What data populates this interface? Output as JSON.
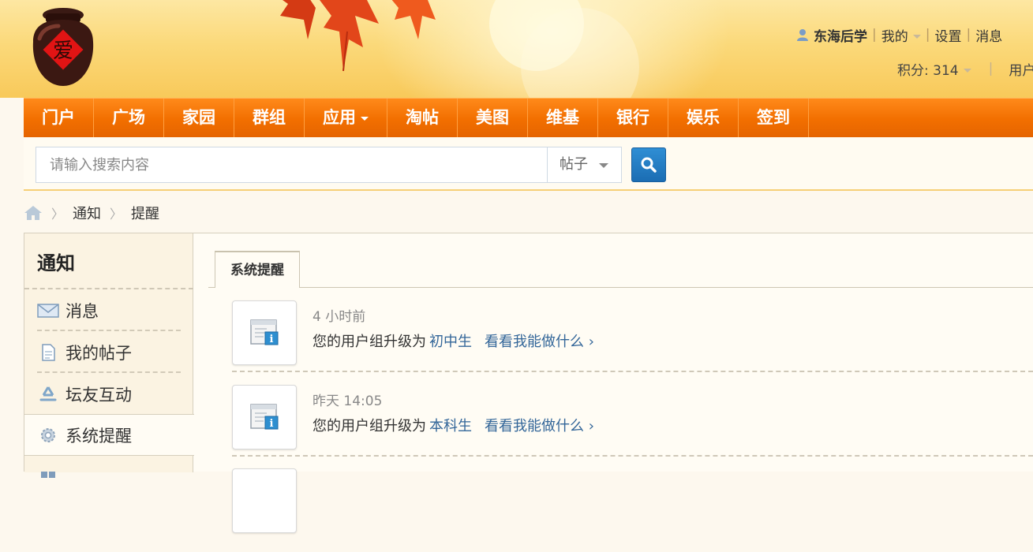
{
  "header": {
    "user_name": "东海后学",
    "user_links": [
      "我的",
      "设置",
      "消息"
    ],
    "credits_label": "积分: 314",
    "trailing_link": "用户"
  },
  "nav": {
    "items": [
      {
        "label": "门户"
      },
      {
        "label": "广场"
      },
      {
        "label": "家园"
      },
      {
        "label": "群组"
      },
      {
        "label": "应用",
        "dropdown": true
      },
      {
        "label": "淘帖"
      },
      {
        "label": "美图"
      },
      {
        "label": "维基"
      },
      {
        "label": "银行"
      },
      {
        "label": "娱乐"
      },
      {
        "label": "签到"
      }
    ]
  },
  "search": {
    "placeholder": "请输入搜索内容",
    "value": "",
    "type_selected": "帖子"
  },
  "breadcrumb": {
    "items": [
      "通知",
      "提醒"
    ]
  },
  "sidebar": {
    "title": "通知",
    "items": [
      {
        "label": "消息",
        "icon": "envelope-icon"
      },
      {
        "label": "我的帖子",
        "icon": "document-icon"
      },
      {
        "label": "坛友互动",
        "icon": "recycle-icon"
      },
      {
        "label": "系统提醒",
        "icon": "gear-icon",
        "active": true
      }
    ]
  },
  "tabs": {
    "active": "系统提醒"
  },
  "notices": [
    {
      "time": "4 小时前",
      "text": "您的用户组升级为",
      "group": "初中生",
      "more": "看看我能做什么 ›"
    },
    {
      "time": "昨天 14:05",
      "text": "您的用户组升级为",
      "group": "本科生",
      "more": "看看我能做什么 ›"
    }
  ],
  "colors": {
    "nav_orange": "#f26f00",
    "link_blue": "#336699",
    "search_button_blue": "#1b6db3"
  }
}
